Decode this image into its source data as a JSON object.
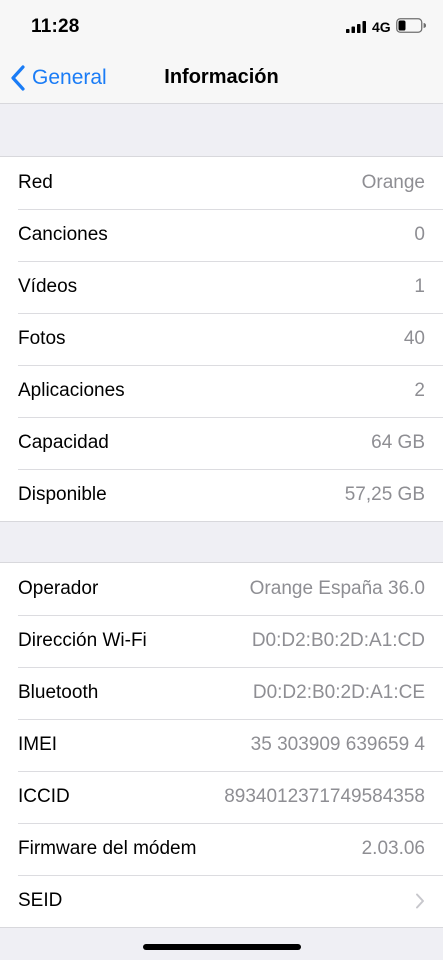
{
  "status_bar": {
    "time": "11:28",
    "network": "4G",
    "icons": [
      "signal-icon",
      "battery-icon"
    ]
  },
  "nav": {
    "back_label": "General",
    "title": "Información",
    "accent_color": "#1a7cf6"
  },
  "groups": [
    {
      "rows": [
        {
          "label": "Red",
          "value": "Orange"
        },
        {
          "label": "Canciones",
          "value": "0"
        },
        {
          "label": "Vídeos",
          "value": "1"
        },
        {
          "label": "Fotos",
          "value": "40"
        },
        {
          "label": "Aplicaciones",
          "value": "2"
        },
        {
          "label": "Capacidad",
          "value": "64 GB"
        },
        {
          "label": "Disponible",
          "value": "57,25 GB"
        }
      ]
    },
    {
      "rows": [
        {
          "label": "Operador",
          "value": "Orange España 36.0"
        },
        {
          "label": "Dirección Wi-Fi",
          "value": "D0:D2:B0:2D:A1:CD"
        },
        {
          "label": "Bluetooth",
          "value": "D0:D2:B0:2D:A1:CE"
        },
        {
          "label": "IMEI",
          "value": "35 303909 639659 4"
        },
        {
          "label": "ICCID",
          "value": "8934012371749584358"
        },
        {
          "label": "Firmware del módem",
          "value": "2.03.06"
        },
        {
          "label": "SEID",
          "value": "",
          "icon": "chevron-right-icon"
        }
      ]
    }
  ]
}
